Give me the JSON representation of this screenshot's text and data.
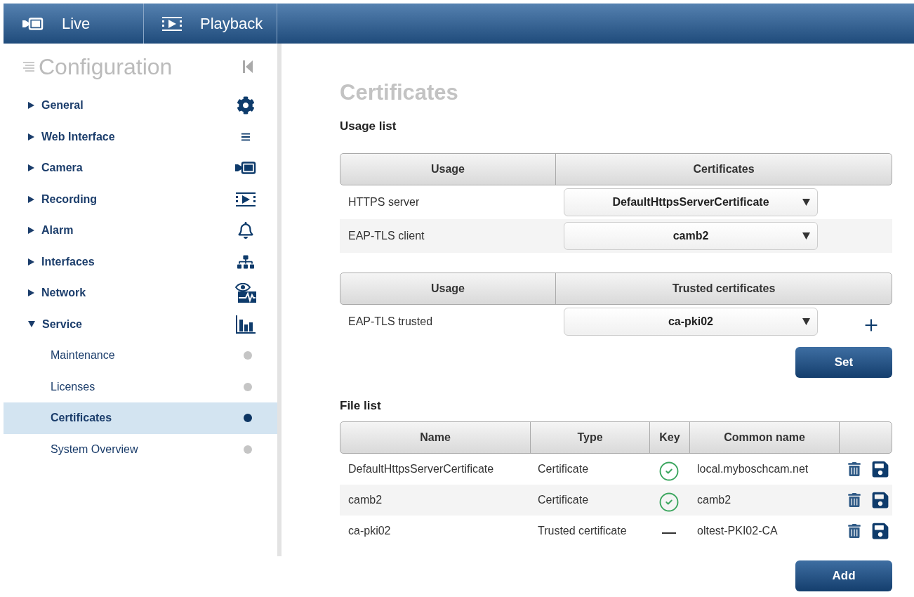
{
  "top_tabs": [
    {
      "label": "Live"
    },
    {
      "label": "Playback"
    }
  ],
  "sidebar": {
    "title": "Configuration",
    "items": [
      {
        "label": "General",
        "expanded": false
      },
      {
        "label": "Web Interface",
        "expanded": false
      },
      {
        "label": "Camera",
        "expanded": false
      },
      {
        "label": "Recording",
        "expanded": false
      },
      {
        "label": "Alarm",
        "expanded": false
      },
      {
        "label": "Interfaces",
        "expanded": false
      },
      {
        "label": "Network",
        "expanded": false
      },
      {
        "label": "Service",
        "expanded": true,
        "children": [
          {
            "label": "Maintenance",
            "selected": false
          },
          {
            "label": "Licenses",
            "selected": false
          },
          {
            "label": "Certificates",
            "selected": true
          },
          {
            "label": "System Overview",
            "selected": false
          }
        ]
      }
    ]
  },
  "page_title": "Certificates",
  "usage_list": {
    "title": "Usage list",
    "tables": [
      {
        "columns": [
          "Usage",
          "Certificates"
        ],
        "rows": [
          {
            "usage": "HTTPS server",
            "certificate": "DefaultHttpsServerCertificate"
          },
          {
            "usage": "EAP-TLS client",
            "certificate": "camb2"
          }
        ]
      },
      {
        "columns": [
          "Usage",
          "Trusted certificates"
        ],
        "addable": true,
        "rows": [
          {
            "usage": "EAP-TLS trusted",
            "certificate": "ca-pki02"
          }
        ]
      }
    ],
    "button": "Set"
  },
  "file_list": {
    "title": "File list",
    "columns": [
      "Name",
      "Type",
      "Key",
      "Common name"
    ],
    "rows": [
      {
        "name": "DefaultHttpsServerCertificate",
        "type": "Certificate",
        "has_key": true,
        "common_name": "local.myboschcam.net"
      },
      {
        "name": "camb2",
        "type": "Certificate",
        "has_key": true,
        "common_name": "camb2"
      },
      {
        "name": "ca-pki02",
        "type": "Trusted certificate",
        "has_key": false,
        "common_name": "oltest-PKI02-CA"
      }
    ],
    "button": "Add"
  }
}
